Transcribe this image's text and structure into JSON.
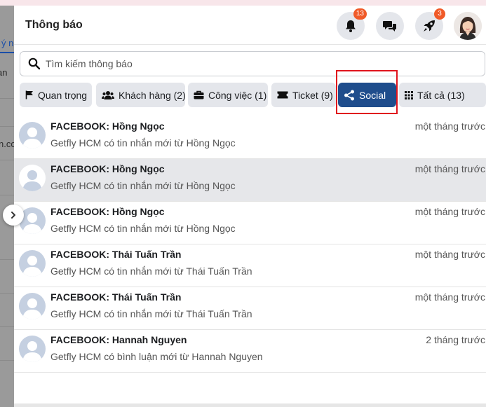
{
  "header": {
    "title": "Thông báo",
    "notification_count": "13",
    "rocket_count": "3"
  },
  "search": {
    "placeholder": "Tìm kiếm thông báo"
  },
  "tabs": [
    {
      "label": "Quan trọng",
      "icon": "flag-icon"
    },
    {
      "label": "Khách hàng (2)",
      "icon": "users-icon"
    },
    {
      "label": "Công việc (1)",
      "icon": "briefcase-icon"
    },
    {
      "label": "Ticket (9)",
      "icon": "ticket-icon"
    },
    {
      "label": "Social",
      "icon": "share-icon",
      "active": true
    },
    {
      "label": "Tất cả (13)",
      "icon": "grid-icon"
    }
  ],
  "notifications": [
    {
      "title": "FACEBOOK: Hồng Ngọc",
      "message": "Getfly HCM có tin nhắn mới từ Hồng Ngọc",
      "time": "một tháng trước"
    },
    {
      "title": "FACEBOOK: Hồng Ngọc",
      "message": "Getfly HCM có tin nhắn mới từ Hồng Ngọc",
      "time": "một tháng trước"
    },
    {
      "title": "FACEBOOK: Hồng Ngọc",
      "message": "Getfly HCM có tin nhắn mới từ Hồng Ngọc",
      "time": "một tháng trước"
    },
    {
      "title": "FACEBOOK: Thái Tuấn Trần",
      "message": "Getfly HCM có tin nhắn mới từ Thái Tuấn Trần",
      "time": "một tháng trước"
    },
    {
      "title": "FACEBOOK: Thái Tuấn Trần",
      "message": "Getfly HCM có tin nhắn mới từ Thái Tuấn Trần",
      "time": "một tháng trước"
    },
    {
      "title": "FACEBOOK: Hannah Nguyen",
      "message": "Getfly HCM có bình luận mới từ Hannah Nguyen",
      "time": "2 tháng trước"
    }
  ],
  "background": {
    "frag1": "ý ng",
    "frag2": "an",
    "frag3": "n.co"
  },
  "colors": {
    "active_tab": "#1f4d8c",
    "badge": "#f05a28",
    "highlight": "#e0141d"
  }
}
